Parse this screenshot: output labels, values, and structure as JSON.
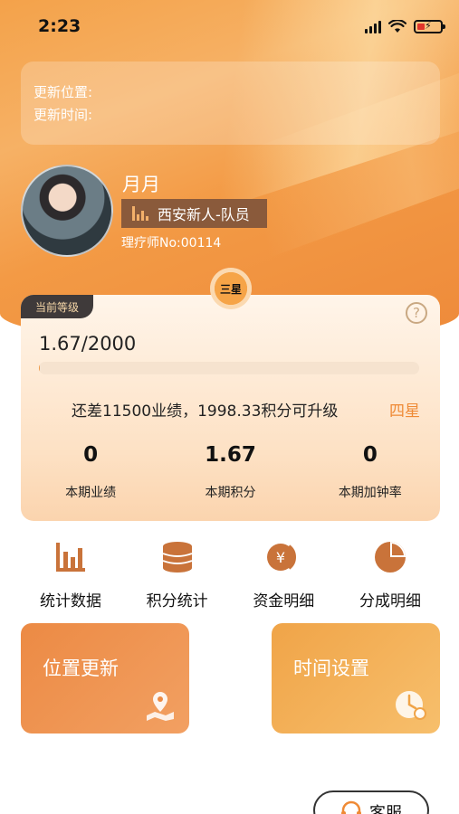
{
  "status_bar": {
    "time": "2:23"
  },
  "location_info": {
    "update_location_label": "更新位置:",
    "update_time_label": "更新时间:"
  },
  "profile": {
    "name": "月月",
    "team": "西安新人-队员",
    "therapist_no": "理疗师No:00114"
  },
  "level": {
    "medal": "三星",
    "tag": "当前等级",
    "help": "?",
    "progress_text": "1.67/2000",
    "progress_fraction": 0.000835,
    "upgrade_hint": "还差11500业绩，1998.33积分可升级",
    "next_level": "四星",
    "stats": [
      {
        "value": "0",
        "label": "本期业绩"
      },
      {
        "value": "1.67",
        "label": "本期积分"
      },
      {
        "value": "0",
        "label": "本期加钟率"
      }
    ]
  },
  "quick_actions": [
    {
      "label": "统计数据",
      "icon": "bar-chart-icon"
    },
    {
      "label": "积分统计",
      "icon": "coin-stack-icon"
    },
    {
      "label": "资金明细",
      "icon": "yuan-coin-icon"
    },
    {
      "label": "分成明细",
      "icon": "pie-chart-icon"
    }
  ],
  "cards": {
    "location_update": "位置更新",
    "time_settings": "时间设置"
  },
  "service": {
    "label": "客服"
  },
  "colors": {
    "accent": "#ee8a3a",
    "next_level_text": "#ef8a35",
    "icon": "#c9733a"
  }
}
